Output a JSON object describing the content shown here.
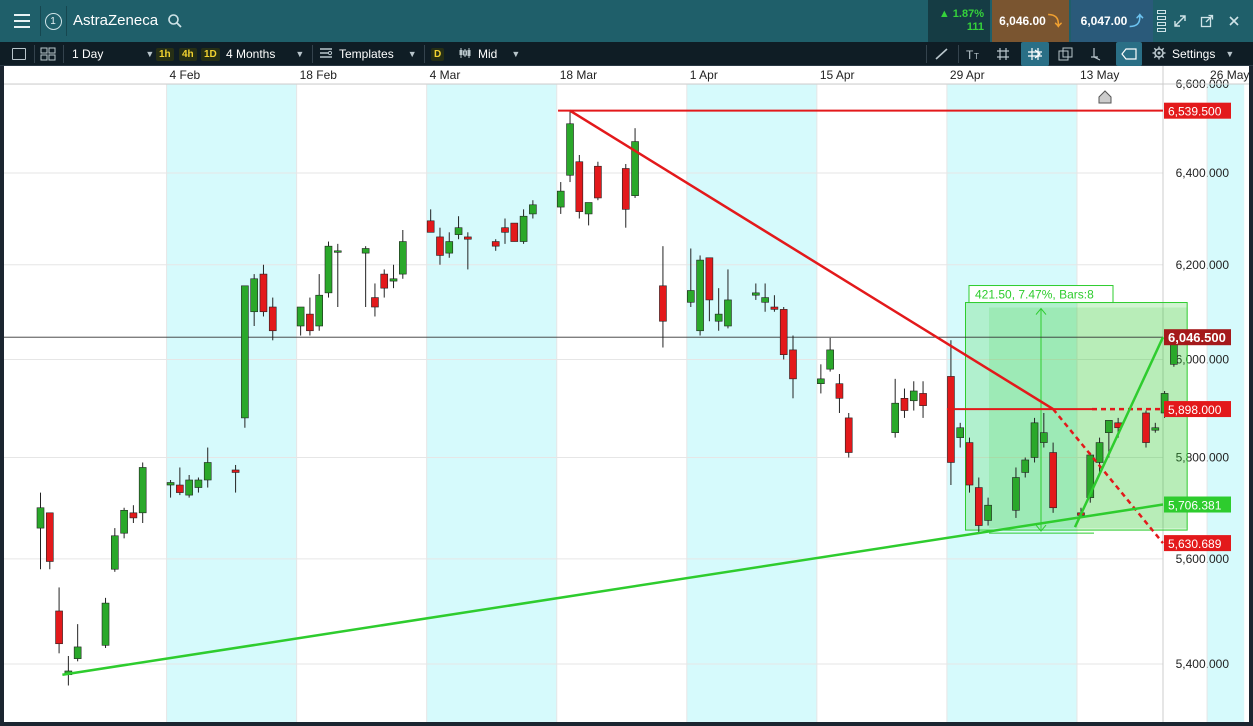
{
  "header": {
    "title": "AstraZeneca",
    "link_number": "1",
    "change_pct": "1.87%",
    "change_pts": "111",
    "sell_price": "6,046.00",
    "buy_price": "6,047.00",
    "colors": {
      "up": "#35d23b",
      "sell_bg": "#7a5530",
      "buy_bg": "#2a5a7a",
      "bar": "#1f5f6a"
    },
    "icons": [
      "menu-icon",
      "search-icon",
      "arrow-down-icon",
      "arrow-up-icon",
      "expand-icon",
      "popout-icon",
      "close-icon"
    ]
  },
  "toolbar": {
    "interval": "1 Day",
    "quick_intervals": [
      "1h",
      "4h",
      "1D"
    ],
    "range": "4 Months",
    "templates_label": "Templates",
    "d_label": "D",
    "price_type": "Mid",
    "settings_label": "Settings",
    "icons": [
      "panel-icon",
      "layout-icon",
      "templates-icon",
      "candles-icon",
      "pencil-icon",
      "text-icon",
      "grid-icon",
      "crosshair-icon",
      "copy-icon",
      "tools-icon",
      "shape-icon",
      "gear-icon"
    ]
  },
  "chart_data": {
    "type": "candlestick",
    "instrument": "AstraZeneca",
    "interval": "1 Day",
    "x_tick_labels": [
      "4 Feb",
      "18 Feb",
      "4 Mar",
      "18 Mar",
      "1 Apr",
      "15 Apr",
      "29 Apr",
      "13 May",
      "26 May"
    ],
    "y_tick_labels": [
      "5,400.000",
      "5,600.000",
      "5,800.000",
      "6,000.000",
      "6,200.000",
      "6,400.000",
      "6,600.000"
    ],
    "ylim": [
      5360,
      6620
    ],
    "y_scale": "log",
    "grid": true,
    "weekend_shading": true,
    "current_price_label": "6,046.500",
    "current_price": 6046.5,
    "price_labels": [
      {
        "text": "6,539.500",
        "value": 6539.5,
        "color": "#e3191b"
      },
      {
        "text": "6,046.500",
        "value": 6046.5,
        "color": "#a5191b"
      },
      {
        "text": "5,898.000",
        "value": 5898.0,
        "color": "#e3191b"
      },
      {
        "text": "5,706.381",
        "value": 5706.381,
        "color": "#2ecc2e"
      },
      {
        "text": "5,630.689",
        "value": 5630.689,
        "color": "#e3191b"
      }
    ],
    "measure_label": "421.50, 7.47%, Bars:8",
    "colors": {
      "up": "#2aa82a",
      "down": "#e3191b",
      "weekend": "#d6fafc",
      "grid": "#e6e6e6",
      "trend_up": "#2ecc2e",
      "trend_down": "#e3191b"
    },
    "candles": [
      {
        "date": "2019-01-21",
        "o": 5660,
        "h": 5730,
        "l": 5580,
        "c": 5700
      },
      {
        "date": "2019-01-22",
        "o": 5690,
        "h": 5690,
        "l": 5580,
        "c": 5595
      },
      {
        "date": "2019-01-23",
        "o": 5500,
        "h": 5545,
        "l": 5420,
        "c": 5438
      },
      {
        "date": "2019-01-24",
        "o": 5380,
        "h": 5415,
        "l": 5360,
        "c": 5387
      },
      {
        "date": "2019-01-25",
        "o": 5410,
        "h": 5475,
        "l": 5405,
        "c": 5432
      },
      {
        "date": "2019-01-28",
        "o": 5435,
        "h": 5525,
        "l": 5430,
        "c": 5515
      },
      {
        "date": "2019-01-29",
        "o": 5580,
        "h": 5660,
        "l": 5575,
        "c": 5645
      },
      {
        "date": "2019-01-30",
        "o": 5650,
        "h": 5700,
        "l": 5640,
        "c": 5695
      },
      {
        "date": "2019-01-31",
        "o": 5690,
        "h": 5705,
        "l": 5670,
        "c": 5680
      },
      {
        "date": "2019-02-01",
        "o": 5690,
        "h": 5790,
        "l": 5670,
        "c": 5780
      },
      {
        "date": "2019-02-04",
        "o": 5745,
        "h": 5755,
        "l": 5720,
        "c": 5750
      },
      {
        "date": "2019-02-05",
        "o": 5745,
        "h": 5780,
        "l": 5725,
        "c": 5730
      },
      {
        "date": "2019-02-06",
        "o": 5725,
        "h": 5765,
        "l": 5720,
        "c": 5755
      },
      {
        "date": "2019-02-07",
        "o": 5740,
        "h": 5760,
        "l": 5730,
        "c": 5755
      },
      {
        "date": "2019-02-08",
        "o": 5755,
        "h": 5820,
        "l": 5740,
        "c": 5790
      },
      {
        "date": "2019-02-11",
        "o": 5775,
        "h": 5785,
        "l": 5730,
        "c": 5770
      },
      {
        "date": "2019-02-12",
        "o": 5880,
        "h": 6000,
        "l": 5860,
        "c": 6155
      },
      {
        "date": "2019-02-13",
        "o": 6100,
        "h": 6180,
        "l": 6070,
        "c": 6170
      },
      {
        "date": "2019-02-14",
        "o": 6180,
        "h": 6200,
        "l": 6090,
        "c": 6100
      },
      {
        "date": "2019-02-15",
        "o": 6110,
        "h": 6130,
        "l": 6040,
        "c": 6060
      },
      {
        "date": "2019-02-18",
        "o": 6070,
        "h": 6110,
        "l": 6050,
        "c": 6110
      },
      {
        "date": "2019-02-19",
        "o": 6095,
        "h": 6130,
        "l": 6050,
        "c": 6060
      },
      {
        "date": "2019-02-20",
        "o": 6070,
        "h": 6180,
        "l": 6060,
        "c": 6135
      },
      {
        "date": "2019-02-21",
        "o": 6140,
        "h": 6250,
        "l": 6130,
        "c": 6240
      },
      {
        "date": "2019-02-22",
        "o": 6230,
        "h": 6245,
        "l": 6110,
        "c": 6230
      },
      {
        "date": "2019-02-25",
        "o": 6225,
        "h": 6240,
        "l": 6110,
        "c": 6235
      },
      {
        "date": "2019-02-26",
        "o": 6130,
        "h": 6160,
        "l": 6090,
        "c": 6110
      },
      {
        "date": "2019-02-27",
        "o": 6180,
        "h": 6190,
        "l": 6130,
        "c": 6150
      },
      {
        "date": "2019-02-28",
        "o": 6165,
        "h": 6200,
        "l": 6150,
        "c": 6170
      },
      {
        "date": "2019-03-01",
        "o": 6180,
        "h": 6275,
        "l": 6170,
        "c": 6250
      },
      {
        "date": "2019-03-04",
        "o": 6295,
        "h": 6320,
        "l": 6270,
        "c": 6270
      },
      {
        "date": "2019-03-05",
        "o": 6260,
        "h": 6280,
        "l": 6200,
        "c": 6220
      },
      {
        "date": "2019-03-06",
        "o": 6225,
        "h": 6270,
        "l": 6215,
        "c": 6250
      },
      {
        "date": "2019-03-07",
        "o": 6265,
        "h": 6305,
        "l": 6255,
        "c": 6280
      },
      {
        "date": "2019-03-08",
        "o": 6260,
        "h": 6270,
        "l": 6190,
        "c": 6255
      },
      {
        "date": "2019-03-11",
        "o": 6250,
        "h": 6255,
        "l": 6230,
        "c": 6240
      },
      {
        "date": "2019-03-12",
        "o": 6280,
        "h": 6300,
        "l": 6245,
        "c": 6270
      },
      {
        "date": "2019-03-13",
        "o": 6290,
        "h": 6290,
        "l": 6250,
        "c": 6250
      },
      {
        "date": "2019-03-14",
        "o": 6250,
        "h": 6320,
        "l": 6245,
        "c": 6305
      },
      {
        "date": "2019-03-15",
        "o": 6310,
        "h": 6340,
        "l": 6300,
        "c": 6330
      },
      {
        "date": "2019-03-18",
        "o": 6325,
        "h": 6380,
        "l": 6310,
        "c": 6360
      },
      {
        "date": "2019-03-19",
        "o": 6395,
        "h": 6540,
        "l": 6380,
        "c": 6510
      },
      {
        "date": "2019-03-20",
        "o": 6425,
        "h": 6440,
        "l": 6300,
        "c": 6315
      },
      {
        "date": "2019-03-21",
        "o": 6310,
        "h": 6335,
        "l": 6285,
        "c": 6335
      },
      {
        "date": "2019-03-22",
        "o": 6415,
        "h": 6425,
        "l": 6340,
        "c": 6345
      },
      {
        "date": "2019-03-25",
        "o": 6410,
        "h": 6420,
        "l": 6280,
        "c": 6320
      },
      {
        "date": "2019-03-26",
        "o": 6350,
        "h": 6500,
        "l": 6345,
        "c": 6470
      },
      {
        "date": "2019-03-29",
        "o": 6155,
        "h": 6240,
        "l": 6025,
        "c": 6080
      },
      {
        "date": "2019-04-01",
        "o": 6120,
        "h": 6235,
        "l": 6110,
        "c": 6145
      },
      {
        "date": "2019-04-02",
        "o": 6060,
        "h": 6220,
        "l": 6050,
        "c": 6210
      },
      {
        "date": "2019-04-03",
        "o": 6215,
        "h": 6200,
        "l": 6080,
        "c": 6125
      },
      {
        "date": "2019-04-04",
        "o": 6080,
        "h": 6150,
        "l": 6060,
        "c": 6095
      },
      {
        "date": "2019-04-05",
        "o": 6070,
        "h": 6190,
        "l": 6065,
        "c": 6125
      },
      {
        "date": "2019-04-08",
        "o": 6135,
        "h": 6160,
        "l": 6125,
        "c": 6140
      },
      {
        "date": "2019-04-09",
        "o": 6120,
        "h": 6160,
        "l": 6100,
        "c": 6130
      },
      {
        "date": "2019-04-10",
        "o": 6110,
        "h": 6135,
        "l": 6100,
        "c": 6105
      },
      {
        "date": "2019-04-11",
        "o": 6105,
        "h": 6110,
        "l": 6000,
        "c": 6010
      },
      {
        "date": "2019-04-12",
        "o": 6020,
        "h": 6050,
        "l": 5920,
        "c": 5960
      },
      {
        "date": "2019-04-15",
        "o": 5950,
        "h": 5990,
        "l": 5930,
        "c": 5960
      },
      {
        "date": "2019-04-16",
        "o": 5980,
        "h": 6045,
        "l": 5975,
        "c": 6020
      },
      {
        "date": "2019-04-17",
        "o": 5950,
        "h": 5970,
        "l": 5890,
        "c": 5920
      },
      {
        "date": "2019-04-18",
        "o": 5880,
        "h": 5890,
        "l": 5800,
        "c": 5810
      },
      {
        "date": "2019-04-23",
        "o": 5850,
        "h": 5960,
        "l": 5840,
        "c": 5910
      },
      {
        "date": "2019-04-24",
        "o": 5920,
        "h": 5940,
        "l": 5880,
        "c": 5895
      },
      {
        "date": "2019-04-25",
        "o": 5915,
        "h": 5955,
        "l": 5895,
        "c": 5935
      },
      {
        "date": "2019-04-26",
        "o": 5930,
        "h": 5955,
        "l": 5880,
        "c": 5905
      },
      {
        "date": "2019-04-29",
        "o": 5965,
        "h": 6040,
        "l": 5745,
        "c": 5790
      },
      {
        "date": "2019-04-30",
        "o": 5840,
        "h": 5870,
        "l": 5820,
        "c": 5860
      },
      {
        "date": "2019-05-01",
        "o": 5830,
        "h": 5840,
        "l": 5730,
        "c": 5745
      },
      {
        "date": "2019-05-02",
        "o": 5740,
        "h": 5760,
        "l": 5650,
        "c": 5665
      },
      {
        "date": "2019-05-03",
        "o": 5675,
        "h": 5720,
        "l": 5665,
        "c": 5705
      },
      {
        "date": "2019-05-06",
        "o": 5695,
        "h": 5780,
        "l": 5680,
        "c": 5760
      },
      {
        "date": "2019-05-07",
        "o": 5770,
        "h": 5800,
        "l": 5760,
        "c": 5795
      },
      {
        "date": "2019-05-08",
        "o": 5800,
        "h": 5880,
        "l": 5790,
        "c": 5870
      },
      {
        "date": "2019-05-09",
        "o": 5830,
        "h": 5890,
        "l": 5820,
        "c": 5850
      },
      {
        "date": "2019-05-10",
        "o": 5810,
        "h": 5830,
        "l": 5690,
        "c": 5700
      },
      {
        "date": "2019-05-13",
        "o": 5690,
        "h": 5700,
        "l": 5680,
        "c": 5685
      },
      {
        "date": "2019-05-14",
        "o": 5720,
        "h": 5810,
        "l": 5710,
        "c": 5805
      },
      {
        "date": "2019-05-15",
        "o": 5790,
        "h": 5840,
        "l": 5770,
        "c": 5830
      },
      {
        "date": "2019-05-16",
        "o": 5850,
        "h": 5875,
        "l": 5800,
        "c": 5875
      },
      {
        "date": "2019-05-17",
        "o": 5870,
        "h": 5880,
        "l": 5840,
        "c": 5860
      },
      {
        "date": "2019-05-20",
        "o": 5890,
        "h": 5895,
        "l": 5820,
        "c": 5830
      },
      {
        "date": "2019-05-21",
        "o": 5855,
        "h": 5870,
        "l": 5850,
        "c": 5860
      },
      {
        "date": "2019-05-22",
        "o": 5890,
        "h": 5935,
        "l": 5880,
        "c": 5930
      },
      {
        "date": "2019-05-23",
        "o": 5990,
        "h": 6050,
        "l": 5985,
        "c": 6046.5
      }
    ],
    "drawings": [
      {
        "name": "resistance-line",
        "kind": "horizontal",
        "value": 6539.5,
        "color": "#e3191b"
      },
      {
        "name": "down-trendline",
        "kind": "trendline",
        "from": {
          "date": "2019-03-19",
          "value": 6539.5
        },
        "to": {
          "date": "2019-05-10",
          "value": 5898.0
        },
        "extend_to": {
          "date": "2019-06-03",
          "value": 5630.689
        },
        "color": "#e3191b"
      },
      {
        "name": "breakout-level",
        "kind": "horizontal-segment",
        "from_date": "2019-04-29",
        "to_date": "2019-06-03",
        "value": 5898.0,
        "color": "#e3191b"
      },
      {
        "name": "long-up-trendline",
        "kind": "trendline",
        "from": {
          "date": "2019-01-24",
          "value": 5380
        },
        "to": {
          "date": "2019-06-03",
          "value": 5706.381
        },
        "color": "#2ecc2e"
      },
      {
        "name": "short-up-trendline",
        "kind": "trendline",
        "from": {
          "date": "2019-05-13",
          "value": 5680
        },
        "to": {
          "date": "2019-06-03",
          "value": 6046.5
        },
        "color": "#2ecc2e"
      },
      {
        "name": "measure-box",
        "kind": "measure",
        "from_date": "2019-05-01",
        "to_date": "2019-05-24",
        "low": 5660,
        "high": 6081.5,
        "color": "#2ecc2e"
      }
    ]
  }
}
